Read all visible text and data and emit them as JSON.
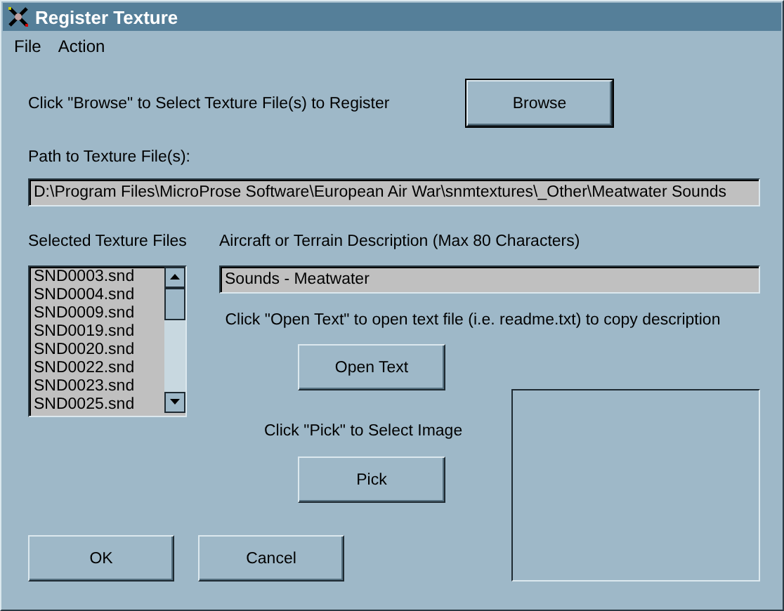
{
  "window": {
    "title": "Register Texture"
  },
  "menu": [
    "File",
    "Action"
  ],
  "browse": {
    "hint": "Click \"Browse\" to Select Texture File(s) to Register",
    "button": "Browse"
  },
  "path": {
    "label": "Path to Texture File(s):",
    "value": "D:\\Program Files\\MicroProse Software\\European Air War\\snmtextures\\_Other\\Meatwater Sounds"
  },
  "files": {
    "label": "Selected Texture Files",
    "items": [
      "SND0003.snd",
      "SND0004.snd",
      "SND0009.snd",
      "SND0019.snd",
      "SND0020.snd",
      "SND0022.snd",
      "SND0023.snd",
      "SND0025.snd"
    ]
  },
  "description": {
    "label": "Aircraft or Terrain Description  (Max 80 Characters)",
    "value": "Sounds - Meatwater"
  },
  "open_text": {
    "hint": "Click \"Open Text\" to open text file (i.e. readme.txt) to copy description",
    "button": "Open Text"
  },
  "pick": {
    "hint": "Click \"Pick\" to Select Image",
    "button": "Pick"
  },
  "buttons": [
    "OK",
    "Cancel"
  ]
}
